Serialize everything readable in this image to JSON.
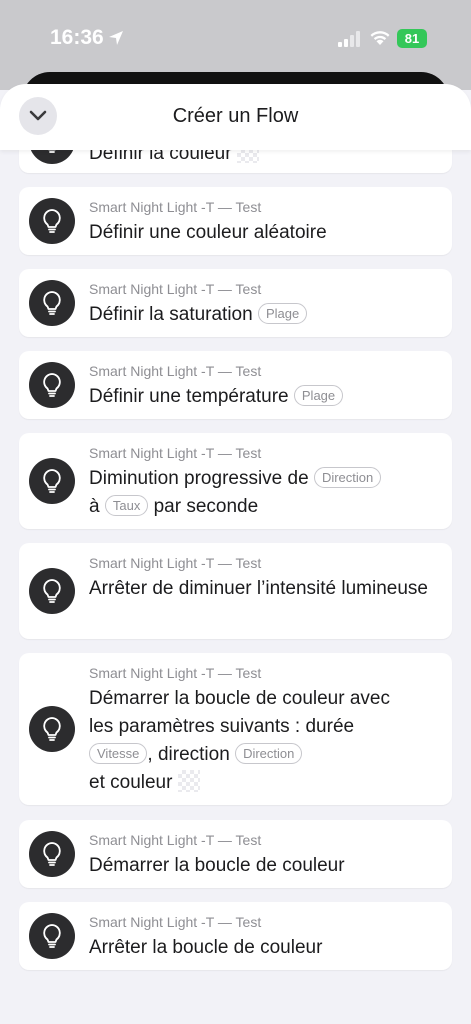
{
  "status": {
    "time": "16:36",
    "battery": "81"
  },
  "header": {
    "title": "Créer un Flow"
  },
  "cards": [
    {
      "main": "Définir la couleur"
    },
    {
      "sub": "Smart Night Light -T — Test",
      "main": "Définir une couleur aléatoire"
    },
    {
      "sub": "Smart Night Light -T — Test",
      "main": "Définir la saturation",
      "chip": "Plage"
    },
    {
      "sub": "Smart Night Light -T — Test",
      "main": "Définir une température",
      "chip": "Plage"
    },
    {
      "sub": "Smart Night Light -T — Test",
      "main1": "Diminution progressive de",
      "chip1": "Direction",
      "main2": "à",
      "chip2": "Taux",
      "main3": "par seconde"
    },
    {
      "sub": "Smart Night Light -T — Test",
      "main": "Arrêter de diminuer l’intensité lumineuse"
    },
    {
      "sub": "Smart Night Light -T — Test",
      "main1": "Démarrer la boucle de couleur avec les paramètres suivants : durée",
      "chip1": "Vitesse",
      "main2": ", direction",
      "chip2": "Direction",
      "main3": "et couleur"
    },
    {
      "sub": "Smart Night Light -T — Test",
      "main": "Démarrer la boucle de couleur"
    },
    {
      "sub": "Smart Night Light -T — Test",
      "main": "Arrêter la boucle de couleur"
    }
  ]
}
